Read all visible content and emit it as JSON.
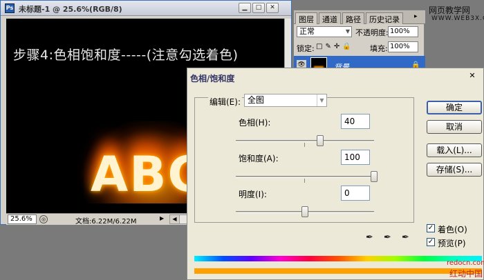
{
  "document": {
    "title": "未标题-1 @ 25.6%(RGB/8)",
    "step_text": "步骤4:色相饱和度-----(注意勾选着色)",
    "canvas_word": "ABC",
    "zoom": "25.6%",
    "doc_size": "文档:6.22M/6.22M",
    "window_buttons": {
      "minimize": "▁",
      "maximize": "□",
      "close": "✕"
    }
  },
  "layers_panel": {
    "tabs": [
      "图层",
      "通道",
      "路径",
      "历史记录"
    ],
    "blend_mode": "正常",
    "opacity_label": "不透明度:",
    "opacity_value": "100%",
    "lock_label": "锁定:",
    "fill_label": "填充:",
    "fill_value": "100%",
    "layer_name": "背景"
  },
  "dialog": {
    "title": "色相/饱和度",
    "edit_label": "编辑(E):",
    "edit_value": "全图",
    "hue_label": "色相(H):",
    "hue_value": "40",
    "saturation_label": "饱和度(A):",
    "saturation_value": "100",
    "lightness_label": "明度(I):",
    "lightness_value": "0",
    "buttons": {
      "ok": "确定",
      "cancel": "取消",
      "load": "载入(L)...",
      "save": "存储(S)..."
    },
    "colorize_label": "着色(O)",
    "colorize_checked": true,
    "preview_label": "预览(P)",
    "preview_checked": true
  },
  "watermark": {
    "top": "网页教学网",
    "top_url": "WWW.WEB3X.COM",
    "bottom_url": "redocn.com",
    "bottom": "红动中国"
  }
}
